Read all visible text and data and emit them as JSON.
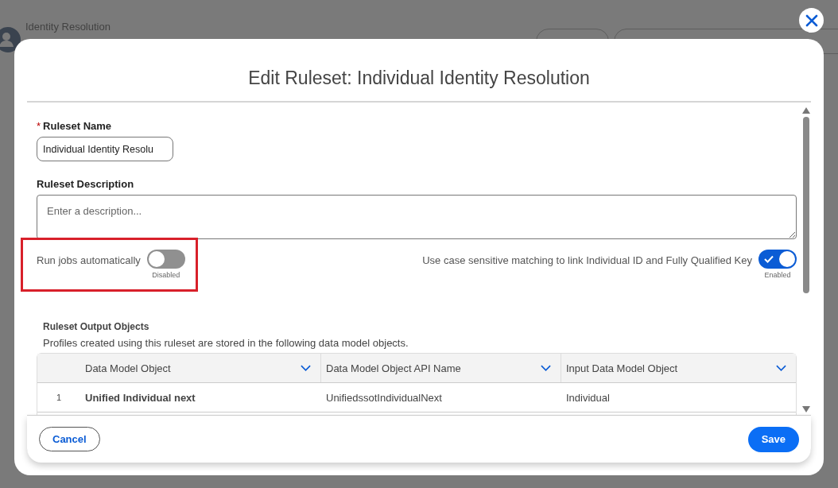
{
  "background": {
    "title": "Identity Resolution"
  },
  "dialog": {
    "title": "Edit Ruleset: Individual Identity Resolution",
    "name_field": {
      "label": "Ruleset Name",
      "required_mark": "*",
      "value": "Individual Identity Resolu"
    },
    "description_field": {
      "label": "Ruleset Description",
      "placeholder": "Enter a description..."
    },
    "toggles": [
      {
        "label": "Run jobs automatically",
        "on": false,
        "status": "Disabled",
        "highlighted": true
      },
      {
        "label": "Use case sensitive matching to link Individual ID and Fully Qualified Key",
        "on": true,
        "status": "Enabled",
        "highlighted": false
      }
    ],
    "output_section": {
      "title": "Ruleset Output Objects",
      "description": "Profiles created using this ruleset are stored in the following data model objects.",
      "table": {
        "columns": [
          "Data Model Object",
          "Data Model Object API Name",
          "Input Data Model Object"
        ],
        "rows": [
          {
            "number": "1",
            "cells": [
              "Unified Individual next",
              "UnifiedssotIndividualNext",
              "Individual"
            ]
          }
        ]
      }
    },
    "buttons": [
      {
        "label": "Cancel",
        "kind": "neutral"
      },
      {
        "label": "Save",
        "kind": "brand"
      }
    ]
  }
}
